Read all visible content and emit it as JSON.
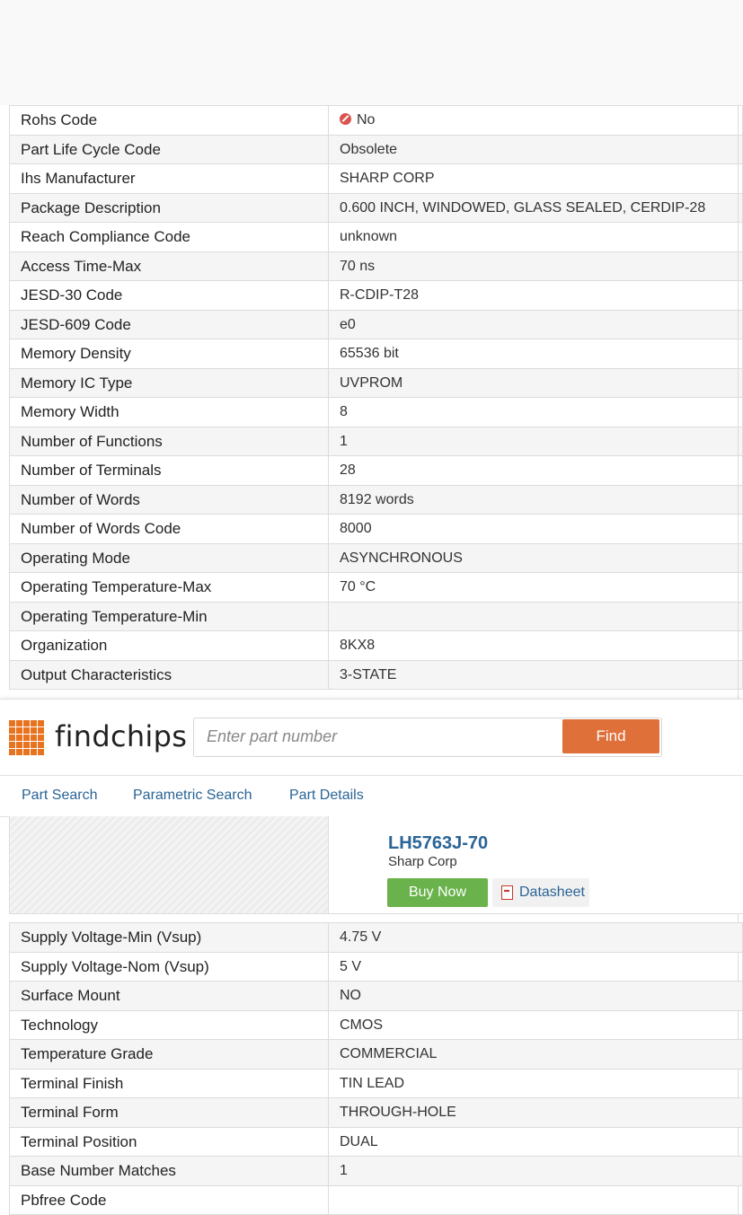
{
  "specs_top": [
    {
      "label": "Rohs Code",
      "value": "No",
      "icon": "rohs-no-icon"
    },
    {
      "label": "Part Life Cycle Code",
      "value": "Obsolete"
    },
    {
      "label": "Ihs Manufacturer",
      "value": "SHARP CORP"
    },
    {
      "label": "Package Description",
      "value": "0.600 INCH, WINDOWED, GLASS SEALED, CERDIP-28"
    },
    {
      "label": "Reach Compliance Code",
      "value": "unknown"
    },
    {
      "label": "Access Time-Max",
      "value": "70 ns"
    },
    {
      "label": "JESD-30 Code",
      "value": "R-CDIP-T28"
    },
    {
      "label": "JESD-609 Code",
      "value": "e0"
    },
    {
      "label": "Memory Density",
      "value": "65536 bit"
    },
    {
      "label": "Memory IC Type",
      "value": "UVPROM"
    },
    {
      "label": "Memory Width",
      "value": "8"
    },
    {
      "label": "Number of Functions",
      "value": "1"
    },
    {
      "label": "Number of Terminals",
      "value": "28"
    },
    {
      "label": "Number of Words",
      "value": "8192 words"
    },
    {
      "label": "Number of Words Code",
      "value": "8000"
    },
    {
      "label": "Operating Mode",
      "value": "ASYNCHRONOUS"
    },
    {
      "label": "Operating Temperature-Max",
      "value": "70 °C"
    },
    {
      "label": "Operating Temperature-Min",
      "value": ""
    },
    {
      "label": "Organization",
      "value": "8KX8"
    },
    {
      "label": "Output Characteristics",
      "value": "3-STATE"
    }
  ],
  "header": {
    "logo_text": "findchips",
    "search_placeholder": "Enter part number",
    "find_label": "Find"
  },
  "nav": {
    "items": [
      "Part Search",
      "Parametric Search",
      "Part Details"
    ]
  },
  "part": {
    "number": "LH5763J-70",
    "manufacturer": "Sharp Corp",
    "buy_label": "Buy Now",
    "datasheet_label": "Datasheet"
  },
  "specs_bottom": [
    {
      "label": "Supply Voltage-Min (Vsup)",
      "value": "4.75 V"
    },
    {
      "label": "Supply Voltage-Nom (Vsup)",
      "value": "5 V"
    },
    {
      "label": "Surface Mount",
      "value": "NO"
    },
    {
      "label": "Technology",
      "value": "CMOS"
    },
    {
      "label": "Temperature Grade",
      "value": "COMMERCIAL"
    },
    {
      "label": "Terminal Finish",
      "value": "TIN LEAD"
    },
    {
      "label": "Terminal Form",
      "value": "THROUGH-HOLE"
    },
    {
      "label": "Terminal Position",
      "value": "DUAL"
    },
    {
      "label": "Base Number Matches",
      "value": "1"
    },
    {
      "label": "Pbfree Code",
      "value": ""
    }
  ],
  "colors": {
    "accent_orange": "#e0703a",
    "buy_green": "#6ab24b",
    "link_blue": "#2a6496"
  }
}
